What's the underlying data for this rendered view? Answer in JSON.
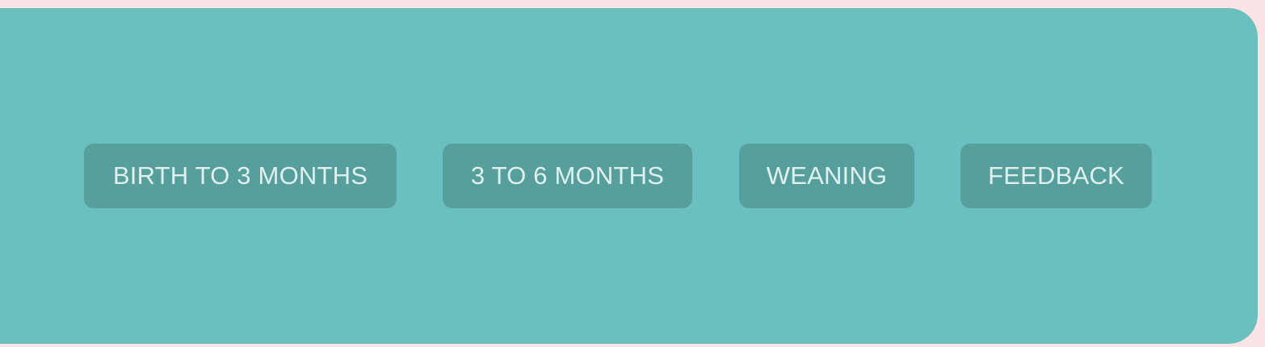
{
  "colors": {
    "page_background": "#fbe3e6",
    "panel_background": "#6ac0bf",
    "button_background": "#569f9c",
    "button_text": "#dff0ee"
  },
  "nav": {
    "items": [
      {
        "label": "BIRTH TO 3 MONTHS"
      },
      {
        "label": "3 TO 6 MONTHS"
      },
      {
        "label": "WEANING"
      },
      {
        "label": "FEEDBACK"
      }
    ]
  }
}
